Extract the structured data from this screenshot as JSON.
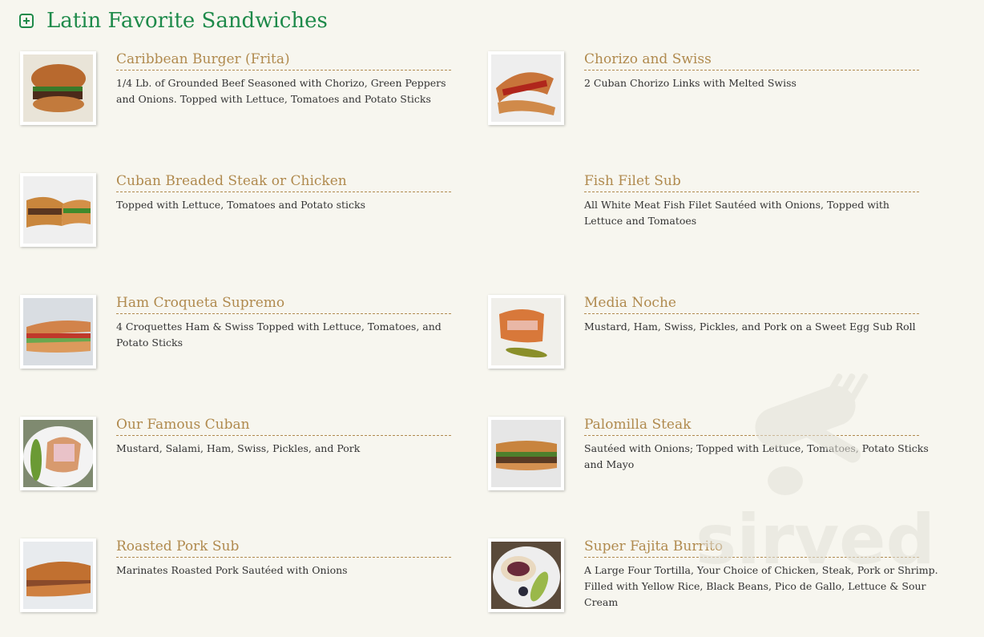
{
  "section": {
    "title": "Latin Favorite Sandwiches",
    "icon": "plus-square-icon"
  },
  "items": [
    {
      "name": "Caribbean Burger (Frita)",
      "description": "1/4 Lb. of Grounded Beef Seasoned with Chorizo, Green Peppers and Onions. Topped with Lettuce, Tomatoes and Potato Sticks",
      "has_photo": true
    },
    {
      "name": "Chorizo and Swiss",
      "description": "2 Cuban Chorizo Links with Melted Swiss",
      "has_photo": true
    },
    {
      "name": "Cuban Breaded Steak or Chicken",
      "description": "Topped with Lettuce, Tomatoes and Potato sticks",
      "has_photo": true
    },
    {
      "name": "Fish Filet Sub",
      "description": "All White Meat Fish Filet Sautéed with Onions, Topped with Lettuce and Tomatoes",
      "has_photo": false
    },
    {
      "name": "Ham Croqueta Supremo",
      "description": "4 Croquettes Ham & Swiss Topped with Lettuce, Tomatoes, and Potato Sticks",
      "has_photo": true
    },
    {
      "name": "Media Noche",
      "description": "Mustard, Ham, Swiss, Pickles, and Pork on a Sweet Egg Sub Roll",
      "has_photo": true
    },
    {
      "name": "Our Famous Cuban",
      "description": "Mustard, Salami, Ham, Swiss, Pickles, and Pork",
      "has_photo": true
    },
    {
      "name": "Palomilla Steak",
      "description": "Sautéed with Onions; Topped with Lettuce, Tomatoes, Potato Sticks and Mayo",
      "has_photo": true
    },
    {
      "name": "Roasted Pork Sub",
      "description": "Marinates Roasted Pork Sautéed with Onions",
      "has_photo": true
    },
    {
      "name": "Super Fajita Burrito",
      "description": "A Large Four Tortilla, Your Choice of Chicken, Steak, Pork or Shrimp. Filled with Yellow Rice, Black Beans, Pico de Gallo, Lettuce & Sour Cream",
      "has_photo": true
    }
  ],
  "watermark": {
    "text": "sirved",
    "icon": "fork-spoon-icon"
  },
  "colors": {
    "background": "#f7f6ef",
    "title": "#1e8a4a",
    "item_name": "#b08a4e",
    "text": "#333333"
  }
}
